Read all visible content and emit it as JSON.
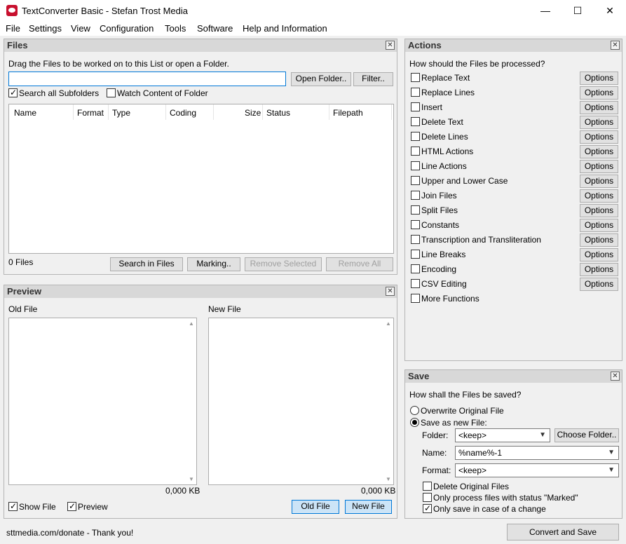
{
  "window": {
    "title": "TextConverter Basic - Stefan Trost Media",
    "min": "—",
    "max": "☐",
    "close": "✕"
  },
  "menu": [
    "File",
    "Settings",
    "View",
    "Configuration",
    "Tools",
    "Software",
    "Help and Information"
  ],
  "files": {
    "title": "Files",
    "hint": "Drag the Files to be worked on to this List or open a Folder.",
    "path_value": "",
    "open_folder": "Open Folder..",
    "filter": "Filter..",
    "search_subfolders": "Search all Subfolders",
    "watch_folder": "Watch Content of Folder",
    "columns": [
      "Name",
      "Format",
      "Type",
      "Coding",
      "Size",
      "Status",
      "Filepath"
    ],
    "count": "0 Files",
    "search_in_files": "Search in Files",
    "marking": "Marking..",
    "remove_selected": "Remove Selected",
    "remove_all": "Remove All"
  },
  "preview": {
    "title": "Preview",
    "old_file_label": "Old File",
    "new_file_label": "New File",
    "old_size": "0,000 KB",
    "new_size": "0,000 KB",
    "show_file": "Show File",
    "preview": "Preview",
    "old_file_btn": "Old File",
    "new_file_btn": "New File"
  },
  "actions": {
    "title": "Actions",
    "question": "How should the Files be processed?",
    "options_label": "Options",
    "items": [
      "Replace Text",
      "Replace Lines",
      "Insert",
      "Delete Text",
      "Delete Lines",
      "HTML Actions",
      "Line Actions",
      "Upper and Lower Case",
      "Join Files",
      "Split Files",
      "Constants",
      "Transcription and Transliteration",
      "Line Breaks",
      "Encoding",
      "CSV Editing",
      "More Functions"
    ]
  },
  "save": {
    "title": "Save",
    "question": "How shall the Files be saved?",
    "overwrite": "Overwrite Original File",
    "save_new": "Save as new File:",
    "folder_label": "Folder:",
    "folder_value": "<keep>",
    "choose_folder": "Choose Folder..",
    "name_label": "Name:",
    "name_value": "%name%-1",
    "format_label": "Format:",
    "format_value": "<keep>",
    "delete_original": "Delete Original Files",
    "only_marked": "Only process files with status \"Marked\"",
    "only_change": "Only save in case of a change"
  },
  "status": {
    "donate": "sttmedia.com/donate - Thank you!",
    "convert": "Convert and Save"
  }
}
